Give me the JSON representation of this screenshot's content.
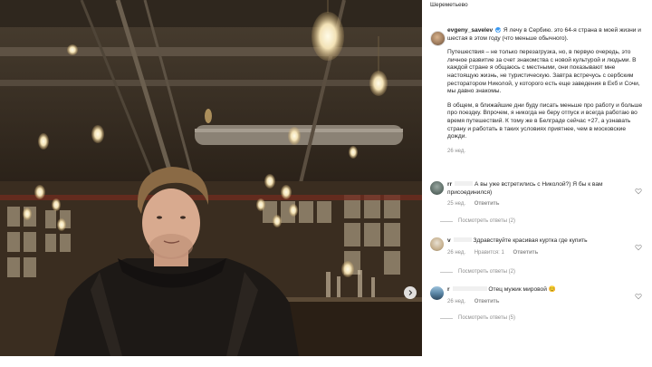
{
  "post": {
    "location": "Шереметьево",
    "author": "evgeny_savelev",
    "caption_first": "Я лечу в Сербию. это 64-я страна в моей жизни и шестая в этом году (что меньше обычного).",
    "caption_para2": "Путешествия – не только перезагрузка, но, в первую очередь, это личное развитие за счет знакомства с новой культурой и людьми. В каждой стране я общаюсь с местными, они показывают мне настоящую жизнь, не туристическую. Завтра встречусь с сербским ресторатором Николой, у которого есть еще заведения в Екб и Сочи, мы давно знакомы.",
    "caption_para3": "В общем, в ближайшие дни буду писать меньше про работу и больше про поездку. Впрочем, я никогда не беру отпуск и всегда работаю во время путешествий. К тому же в Белграде сейчас +27, а узнавать страну и работать в таких условиях приятнее, чем в московские дожди.",
    "time": "26 нед."
  },
  "comments": [
    {
      "user": "rr",
      "text": "А вы уже встретились с Николой?) Я бы к вам присоединился)",
      "time": "25 нед.",
      "reply_label": "Ответить",
      "likes_label": "",
      "view_replies": "Посмотреть ответы (2)"
    },
    {
      "user": "v",
      "text": "Здравствуйте красивая куртка где купить",
      "time": "26 нед.",
      "likes_label": "Нравится: 1",
      "reply_label": "Ответить",
      "view_replies": "Посмотреть ответы (2)"
    },
    {
      "user": "r",
      "text": "Отец мужик мировой",
      "emoji": "😊",
      "time": "26 нед.",
      "reply_label": "Ответить",
      "likes_label": "",
      "view_replies": "Посмотреть ответы (5)"
    }
  ],
  "icons": {
    "carousel_next": "chevron-right-icon",
    "verified": "verified-badge-icon",
    "like": "heart-icon"
  },
  "colors": {
    "verified": "#3897f0",
    "muted": "#8e8e8e",
    "text": "#262626"
  }
}
